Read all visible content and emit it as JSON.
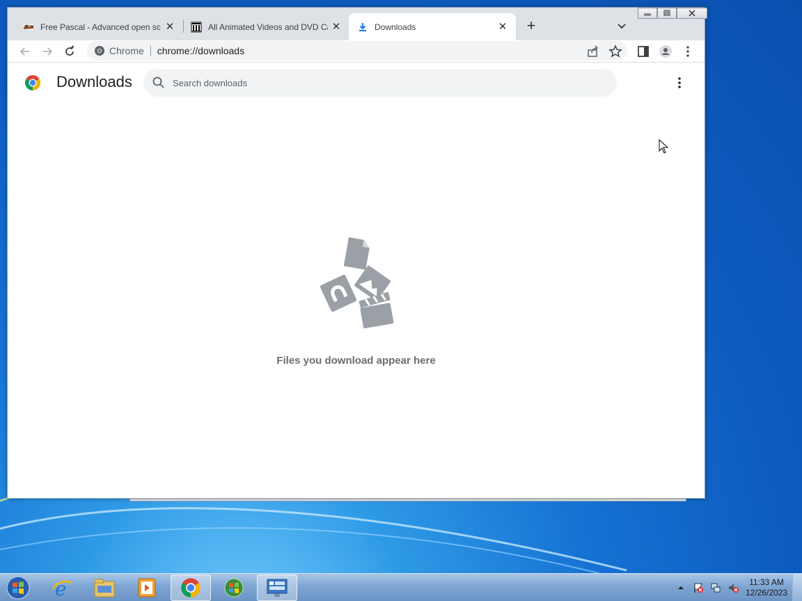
{
  "browser": {
    "tabs": [
      {
        "title": "Free Pascal - Advanced open sou",
        "favicon": "free-pascal-icon",
        "active": false
      },
      {
        "title": "All Animated Videos and DVD Ca",
        "favicon": "archive-icon",
        "active": false
      },
      {
        "title": "Downloads",
        "favicon": "download-icon",
        "active": true
      }
    ],
    "new_tab_label": "+",
    "omnibox": {
      "site_label": "Chrome",
      "url": "chrome://downloads"
    }
  },
  "downloads_page": {
    "title": "Downloads",
    "search_placeholder": "Search downloads",
    "empty_message": "Files you download appear here"
  },
  "taskbar": {
    "apps": [
      "internet-explorer-icon",
      "file-explorer-icon",
      "media-player-icon",
      "chrome-icon",
      "windows-update-icon",
      "network-app-icon"
    ],
    "clock": {
      "time": "11:33 AM",
      "date": "12/26/2023"
    }
  },
  "colors": {
    "accent_blue": "#1a73e8",
    "empty_art_gray": "#9aa0a6",
    "titlebar": "#dee1e6"
  }
}
